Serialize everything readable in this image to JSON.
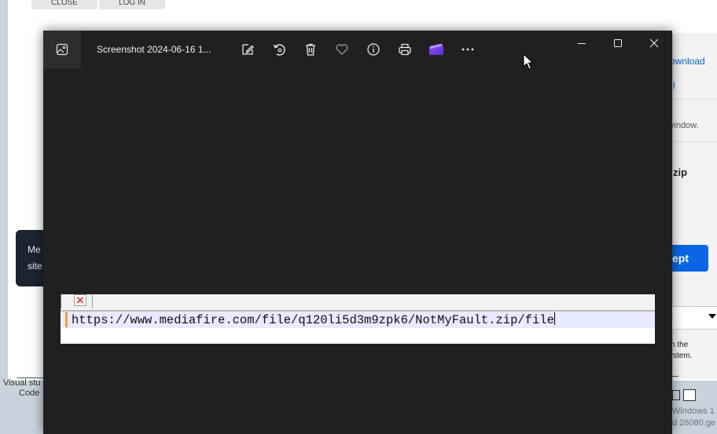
{
  "background": {
    "top_buttons": [
      "CLOSE",
      "LOG IN"
    ],
    "panel": {
      "download_link": "ownload",
      "link_fragment": "l",
      "window_text": "vindow.",
      "zip_text": "zip",
      "accept_button": "ept",
      "select_value": ")",
      "notice_line1": "h the",
      "notice_line2": "ystem."
    },
    "cookie_text_line1": "Me",
    "cookie_text_line2": "site",
    "taskbar_label_line1": "Visual stu",
    "taskbar_label_line2": "Code",
    "watermark_line1": "Windows 1",
    "watermark_line2": "d 26080.ge"
  },
  "viewer": {
    "title": "Screenshot 2024-06-16 1...",
    "toolbar": [
      {
        "name": "edit-icon",
        "label": "Edit"
      },
      {
        "name": "rotate-icon",
        "label": "Rotate"
      },
      {
        "name": "delete-icon",
        "label": "Delete"
      },
      {
        "name": "favorite-icon",
        "label": "Favorite"
      },
      {
        "name": "info-icon",
        "label": "File info"
      },
      {
        "name": "print-icon",
        "label": "Print"
      },
      {
        "name": "clipchamp-icon",
        "label": "Edit with Clipchamp"
      },
      {
        "name": "more-icon",
        "label": "See more"
      }
    ],
    "window_controls": [
      "minimize",
      "maximize",
      "close"
    ],
    "image": {
      "url_text": "https://www.mediafire.com/file/q120li5d3m9zpk6/NotMyFault.zip/file"
    }
  },
  "colors": {
    "viewer_bg": "#202020",
    "accent_accept": "#0a66e4",
    "field_bg": "#e9e9ff"
  }
}
